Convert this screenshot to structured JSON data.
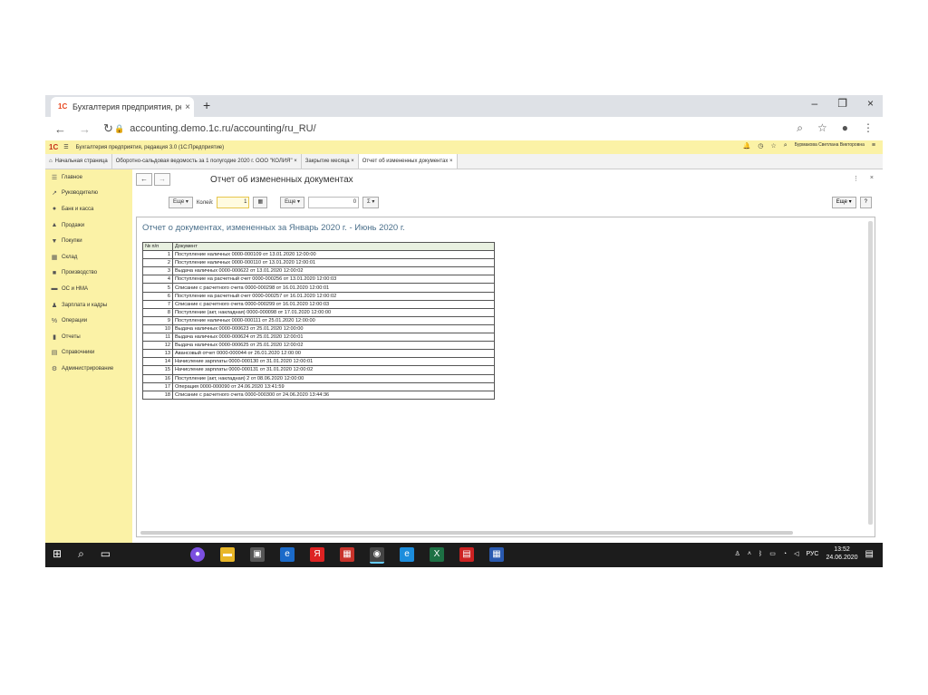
{
  "browser": {
    "tab_title": "Бухгалтерия предприятия, реда",
    "url": "accounting.demo.1c.ru/accounting/ru_RU/"
  },
  "app": {
    "logo": "1С",
    "header_title": "Бухгалтерия предприятия, редакция 3.0  (1С:Предприятие)",
    "user": "Бурмакова Светлана Викторовна"
  },
  "open_tabs": [
    {
      "label": "Начальная страница"
    },
    {
      "label": "Оборотно-сальдовая ведомость за 1 полугодие 2020 г. ООО \"КОЛИЯ\"  ×"
    },
    {
      "label": "Закрытие месяца  ×"
    },
    {
      "label": "Отчет об измененных документах  ×"
    }
  ],
  "sidebar": {
    "items": [
      {
        "label": "Главное",
        "icon": "☰"
      },
      {
        "label": "Руководителю",
        "icon": "↗"
      },
      {
        "label": "Банк и касса",
        "icon": "●"
      },
      {
        "label": "Продажи",
        "icon": "▲"
      },
      {
        "label": "Покупки",
        "icon": "▼"
      },
      {
        "label": "Склад",
        "icon": "▦"
      },
      {
        "label": "Производство",
        "icon": "■"
      },
      {
        "label": "ОС и НМА",
        "icon": "▬"
      },
      {
        "label": "Зарплата и кадры",
        "icon": "♟"
      },
      {
        "label": "Операции",
        "icon": "%"
      },
      {
        "label": "Отчеты",
        "icon": "▮"
      },
      {
        "label": "Справочники",
        "icon": "▤"
      },
      {
        "label": "Администрирование",
        "icon": "⚙"
      }
    ]
  },
  "content": {
    "title": "Отчет об измененных документах",
    "toolbar": {
      "more_label": "Еще",
      "count_label": "Колей:",
      "count_value": "1",
      "more2_label": "Еще",
      "sum_value": "0",
      "sigma": "Σ",
      "more_right": "Еще",
      "help": "?"
    },
    "report_title": "Отчет о документах, измененных за Январь 2020 г. - Июнь 2020 г.",
    "columns": [
      "№ п/п",
      "Документ"
    ],
    "rows": [
      {
        "n": "1",
        "doc": "Поступление наличных 0000-000109 от 13.01.2020 12:00:00"
      },
      {
        "n": "2",
        "doc": "Поступление наличных 0000-000110 от 13.01.2020 12:00:01"
      },
      {
        "n": "3",
        "doc": "Выдача наличных 0000-000622 от 13.01.2020 12:00:02"
      },
      {
        "n": "4",
        "doc": "Поступление на расчетный счет 0000-000256 от 13.01.2020 12:00:03"
      },
      {
        "n": "5",
        "doc": "Списание с расчетного счета 0000-000298 от 16.01.2020 12:00:01"
      },
      {
        "n": "6",
        "doc": "Поступление на расчетный счет 0000-000257 от 16.01.2020 12:00:02"
      },
      {
        "n": "7",
        "doc": "Списание с расчетного счета 0000-000299 от 16.01.2020 12:00:03"
      },
      {
        "n": "8",
        "doc": "Поступление (акт, накладная) 0000-000098 от 17.01.2020 12:00:00"
      },
      {
        "n": "9",
        "doc": "Поступление наличных 0000-000111 от 25.01.2020 12:00:00"
      },
      {
        "n": "10",
        "doc": "Выдача наличных 0000-000623 от 25.01.2020 12:00:00"
      },
      {
        "n": "11",
        "doc": "Выдача наличных 0000-000624 от 25.01.2020 12:00:01"
      },
      {
        "n": "12",
        "doc": "Выдача наличных 0000-000625 от 25.01.2020 12:00:02"
      },
      {
        "n": "13",
        "doc": "Авансовый отчет 0000-000044 от 26.01.2020 12:00:00"
      },
      {
        "n": "14",
        "doc": "Начисление зарплаты 0000-000130 от 31.01.2020 12:00:01"
      },
      {
        "n": "15",
        "doc": "Начисление зарплаты 0000-000131 от 31.01.2020 12:00:02"
      },
      {
        "n": "16",
        "doc": "Поступление (акт, накладная) 2 от 08.06.2020 12:00:00"
      },
      {
        "n": "17",
        "doc": "Операция 0000-000090 от 24.06.2020 13:41:59"
      },
      {
        "n": "18",
        "doc": "Списание с расчетного счета 0000-000300 от 24.06.2020 13:44:36"
      }
    ]
  },
  "taskbar": {
    "lang": "РУС",
    "time": "13:52",
    "date": "24.06.2020"
  },
  "colors": {
    "sidebar_bg": "#fbf2a6",
    "report_title": "#4a6f8a",
    "taskbar": "#1c1c1c"
  }
}
